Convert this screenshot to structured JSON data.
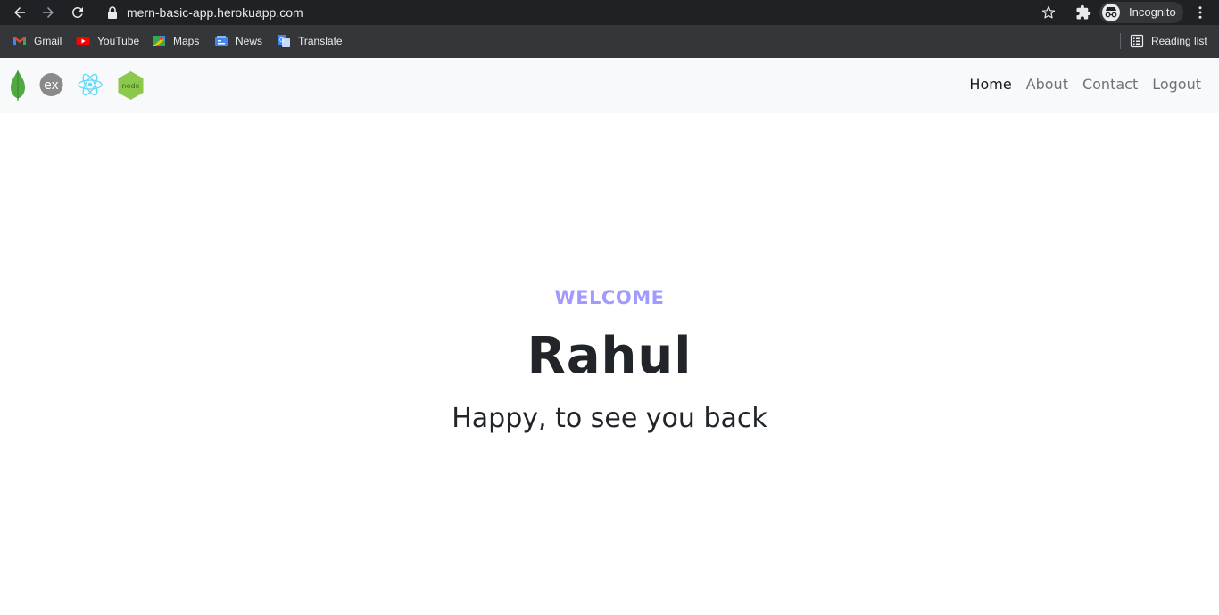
{
  "browser": {
    "url": "mern-basic-app.herokuapp.com",
    "profile_label": "Incognito",
    "bookmarks": [
      {
        "label": "Gmail",
        "icon": "gmail-icon"
      },
      {
        "label": "YouTube",
        "icon": "youtube-icon"
      },
      {
        "label": "Maps",
        "icon": "maps-icon"
      },
      {
        "label": "News",
        "icon": "news-icon"
      },
      {
        "label": "Translate",
        "icon": "translate-icon"
      }
    ],
    "reading_list_label": "Reading list"
  },
  "navbar": {
    "logos": [
      "mongodb-logo",
      "express-logo",
      "react-logo",
      "nodejs-logo"
    ],
    "express_text": "ex",
    "node_text": "node",
    "links": [
      {
        "label": "Home",
        "active": true
      },
      {
        "label": "About",
        "active": false
      },
      {
        "label": "Contact",
        "active": false
      },
      {
        "label": "Logout",
        "active": false
      }
    ]
  },
  "hero": {
    "eyebrow": "WELCOME",
    "name": "Rahul",
    "subtitle": "Happy, to see you back"
  },
  "colors": {
    "accent": "#a29bfe",
    "chrome_dark": "#202124",
    "bookmarks_bar": "#35363a",
    "navbar_bg": "#f8f9fa",
    "text_dark": "#212529"
  }
}
